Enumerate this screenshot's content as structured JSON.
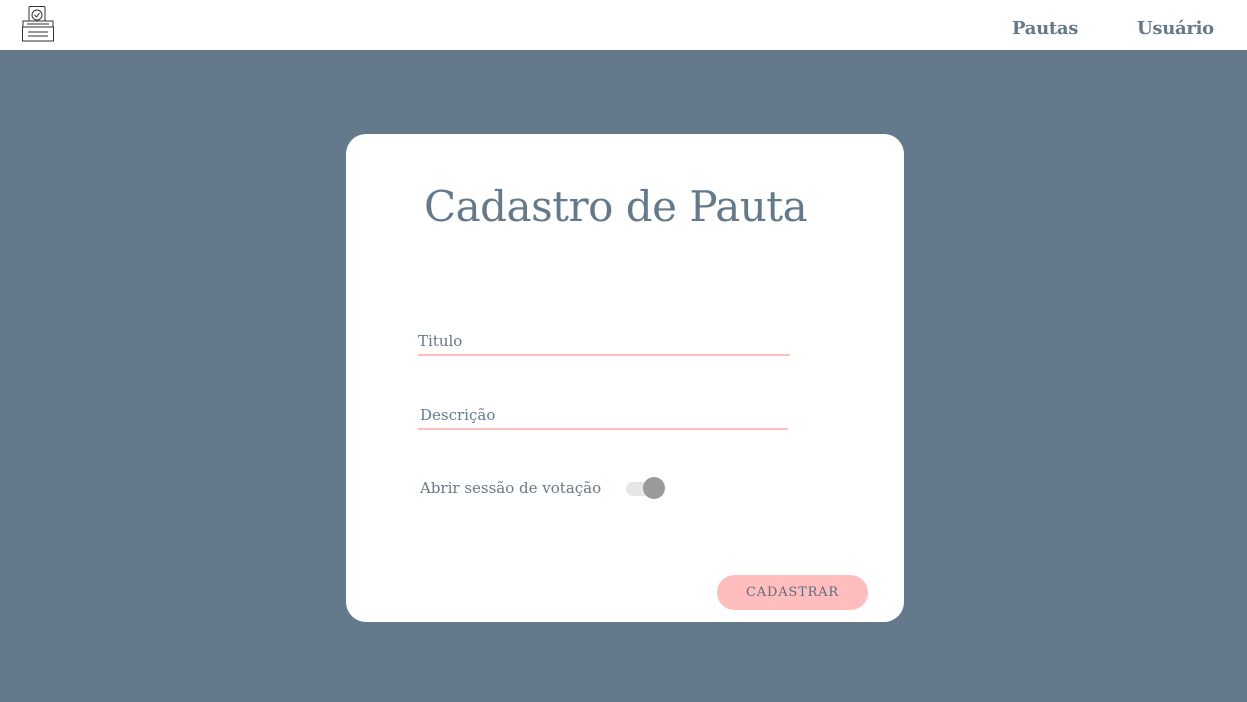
{
  "header": {
    "logo_icon": "ballot-box-icon",
    "nav": [
      {
        "label": "Pautas"
      },
      {
        "label": "Usuário"
      }
    ]
  },
  "form": {
    "title": "Cadastro de Pauta",
    "fields": {
      "titulo": {
        "placeholder": "Titulo",
        "value": ""
      },
      "descricao": {
        "placeholder": "Descrição",
        "value": ""
      }
    },
    "toggle": {
      "label": "Abrir sessão de votação",
      "checked": true
    },
    "submit_label": "CADASTRAR"
  },
  "colors": {
    "background": "#64798b",
    "text": "#64798b",
    "accent": "#ffbdbd",
    "card": "#ffffff"
  }
}
